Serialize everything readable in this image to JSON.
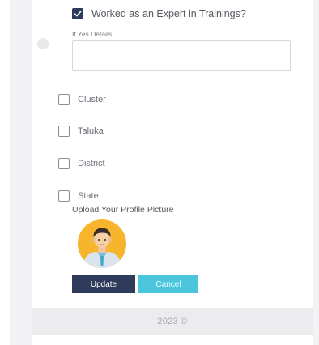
{
  "form": {
    "expert_training": {
      "label": "Worked as an Expert in Trainings?",
      "checked": true
    },
    "details": {
      "label": "If Yes Details.",
      "value": ""
    },
    "levels": [
      {
        "label": "Cluster",
        "checked": false
      },
      {
        "label": "Taluka",
        "checked": false
      },
      {
        "label": "District",
        "checked": false
      },
      {
        "label": "State",
        "checked": false
      }
    ],
    "upload_label": "Upload Your Profile Picture",
    "update_label": "Update",
    "cancel_label": "Cancel"
  },
  "footer": {
    "text": "2023 ©"
  },
  "colors": {
    "primary_button": "#2f3b5a",
    "cancel_button": "#4cc6dd",
    "avatar_circle": "#f6b52c"
  },
  "icons": {
    "checkmark": "check-icon",
    "avatar": "user-avatar-icon"
  }
}
